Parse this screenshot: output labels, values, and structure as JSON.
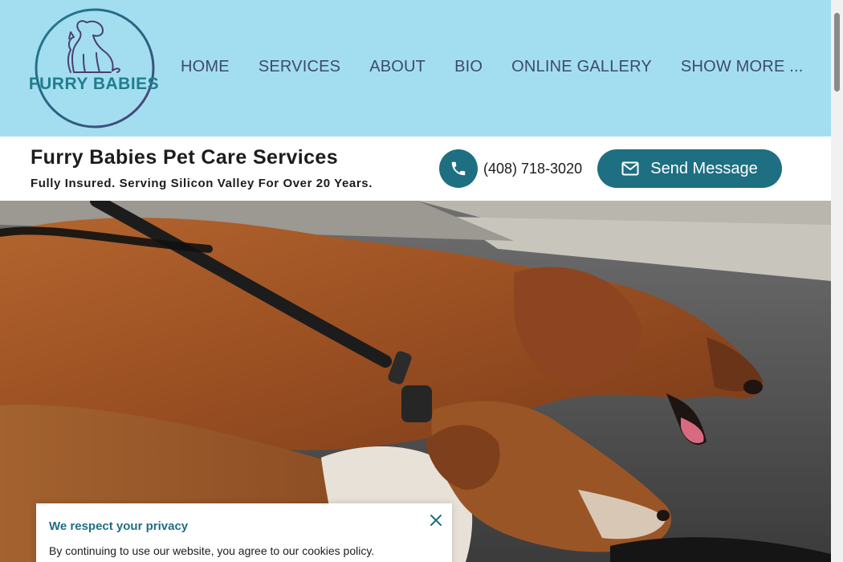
{
  "logo": {
    "text": "FURRY BABIES",
    "icon": "dog-cat-outline-logo"
  },
  "nav": {
    "items": [
      {
        "label": "HOME"
      },
      {
        "label": "SERVICES"
      },
      {
        "label": "ABOUT"
      },
      {
        "label": "BIO"
      },
      {
        "label": "ONLINE GALLERY"
      },
      {
        "label": "SHOW MORE ..."
      }
    ]
  },
  "business": {
    "name": "Furry Babies Pet Care Services",
    "tagline": "Fully Insured. Serving Silicon Valley For Over 20 Years."
  },
  "contact": {
    "phone_icon": "phone-icon",
    "phone": "(408) 718-3020",
    "message_icon": "envelope-icon",
    "message_label": "Send Message"
  },
  "hero": {
    "image": "two dogs walking on leash"
  },
  "privacy": {
    "title": "We respect your privacy",
    "text": "By continuing to use our website, you agree to our cookies policy.",
    "close_icon": "close-icon"
  },
  "colors": {
    "header_bg": "#a3def0",
    "nav_text": "#3d4a6e",
    "brand_teal": "#1e6f82"
  }
}
